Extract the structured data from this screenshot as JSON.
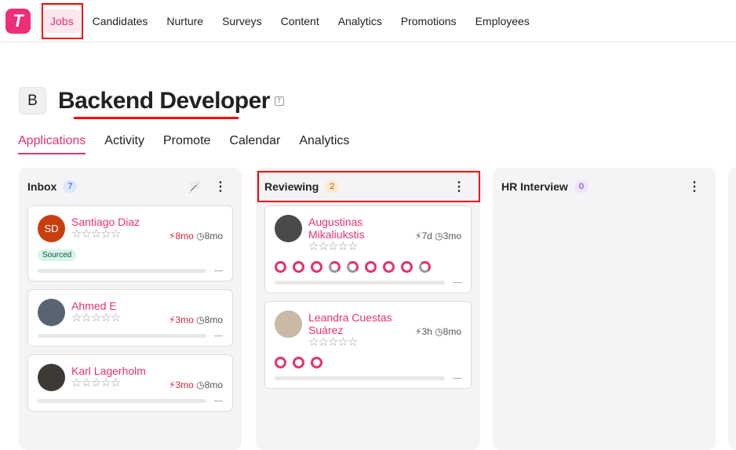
{
  "nav": {
    "logo": "T",
    "items": [
      "Jobs",
      "Candidates",
      "Nurture",
      "Surveys",
      "Content",
      "Analytics",
      "Promotions",
      "Employees"
    ],
    "active": 0
  },
  "job": {
    "initial": "B",
    "title": "Backend Developer",
    "template_icon": "T"
  },
  "tabs": [
    "Applications",
    "Activity",
    "Promote",
    "Calendar",
    "Analytics"
  ],
  "columns": [
    {
      "name": "Inbox",
      "count": "7",
      "count_bg": "#dde6fd",
      "count_color": "#2a4cbf",
      "magic": true,
      "cards": [
        {
          "name": "Santiago Diaz",
          "initials": "SD",
          "avatar_color": "#c83f0e",
          "hot": "8mo",
          "hot_red": true,
          "age": "8mo",
          "tag": "Sourced"
        },
        {
          "name": "Ahmed E",
          "initials": "",
          "avatar_color": "#5a6470",
          "hot": "3mo",
          "hot_red": true,
          "age": "8mo"
        },
        {
          "name": "Karl Lagerholm",
          "initials": "",
          "avatar_color": "#3d3a36",
          "hot": "3mo",
          "hot_red": true,
          "age": "8mo"
        }
      ]
    },
    {
      "name": "Reviewing",
      "count": "2",
      "count_bg": "#fde9d2",
      "count_color": "#b5620a",
      "magic": false,
      "cards": [
        {
          "name": "Augustinas Mikaliukstis",
          "initials": "",
          "avatar_color": "#4a4a48",
          "hot": "7d",
          "hot_red": false,
          "age": "3mo",
          "dots": [
            0,
            0,
            0,
            1,
            1,
            0,
            0,
            0,
            1
          ]
        },
        {
          "name": "Leandra Cuestas Suárez",
          "initials": "",
          "avatar_color": "#c9b9a5",
          "hot": "3h",
          "hot_red": false,
          "age": "8mo",
          "dots": [
            0,
            0,
            0
          ]
        }
      ]
    },
    {
      "name": "HR Interview",
      "count": "0",
      "count_bg": "#efe3fd",
      "count_color": "#6a2fb8",
      "magic": false,
      "cards": []
    }
  ]
}
